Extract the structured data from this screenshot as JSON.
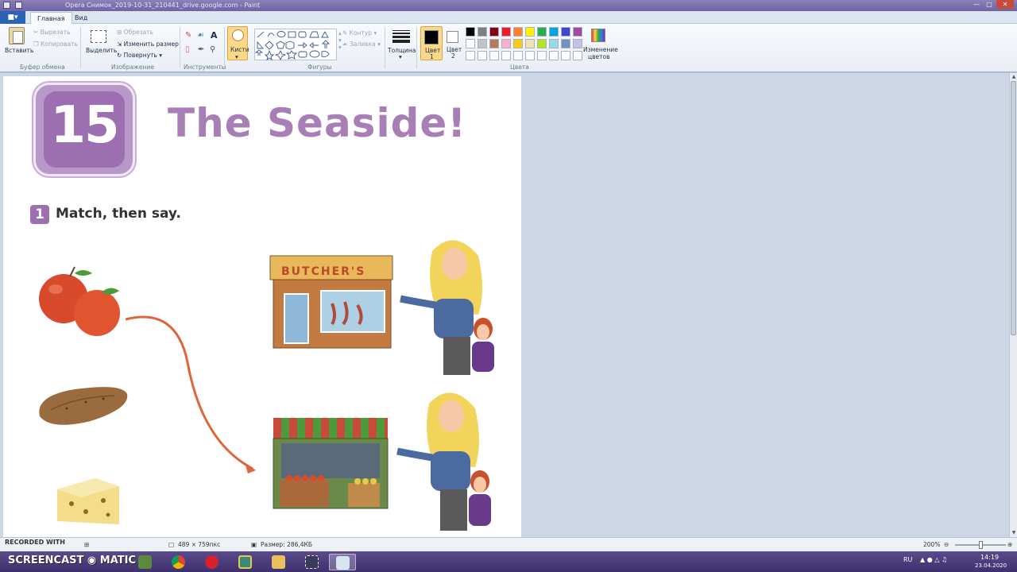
{
  "window": {
    "title": "Opera Снимок_2019-10-31_210441_drive.google.com - Paint"
  },
  "tabs": [
    {
      "label": "Главная",
      "active": true
    },
    {
      "label": "Вид",
      "active": false
    }
  ],
  "ribbon": {
    "clipboard": {
      "paste": "Вставить",
      "cut": "Вырезать",
      "copy": "Копировать",
      "group": "Буфер обмена"
    },
    "image": {
      "select": "Выделить",
      "crop": "Обрезать",
      "resize": "Изменить размер",
      "rotate": "Повернуть",
      "group": "Изображение"
    },
    "tools": {
      "group": "Инструменты",
      "text_tool": "A"
    },
    "brushes": {
      "label": "Кисти"
    },
    "shapes": {
      "group": "Фигуры",
      "outline": "Контур",
      "fill": "Заливка"
    },
    "thickness": {
      "label": "Толщина"
    },
    "colors": {
      "color1": "Цвет\n1",
      "color1_line1": "Цвет",
      "color1_line2": "1",
      "color2_line1": "Цвет",
      "color2_line2": "2",
      "edit_line1": "Изменение",
      "edit_line2": "цветов",
      "group": "Цвета",
      "color1_value": "#000000",
      "color2_value": "#ffffff",
      "palette": [
        "#000000",
        "#7f7f7f",
        "#880015",
        "#ed1c24",
        "#ff7f27",
        "#fff200",
        "#22b14c",
        "#00a2e8",
        "#3f48cc",
        "#a349a4",
        "#ffffff",
        "#c3c3c3",
        "#b97a57",
        "#ffaec9",
        "#ffc90e",
        "#efe4b0",
        "#b5e61d",
        "#99d9ea",
        "#7092be",
        "#c8bfe7",
        "#ffffff",
        "#ffffff",
        "#ffffff",
        "#ffffff",
        "#ffffff",
        "#ffffff",
        "#ffffff",
        "#ffffff",
        "#ffffff",
        "#ffffff"
      ]
    }
  },
  "canvas": {
    "unit_number": "15",
    "title": "The Seaside!",
    "exercise_number": "1",
    "exercise_text": "Match, then say.",
    "shop_sign": "BUTCHER'S"
  },
  "status": {
    "dimensions": "489 × 759пкс",
    "size": "Размер: 286,4КБ",
    "zoom": "200%"
  },
  "overlay": {
    "recorded": "RECORDED WITH",
    "brand": "SCREENCAST",
    "brand2": "MATIC"
  },
  "taskbar": {
    "lang": "RU",
    "time": "14:19",
    "date": "23.04.2020"
  }
}
